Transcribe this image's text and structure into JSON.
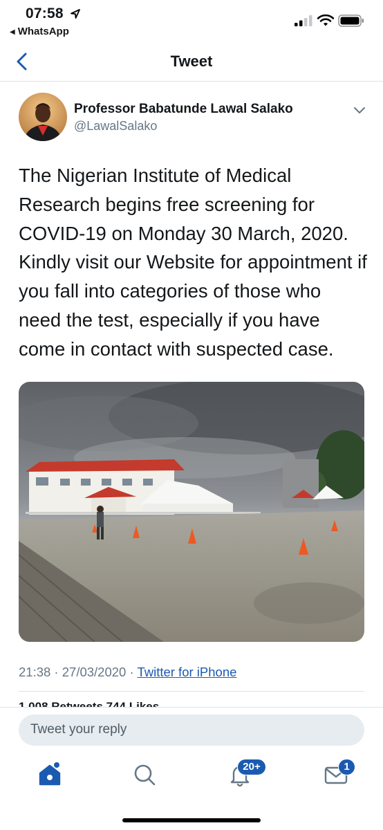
{
  "status_bar": {
    "time": "07:58",
    "back_app": "WhatsApp",
    "icons": [
      "location-arrow-icon",
      "signal-icon",
      "wifi-icon",
      "battery-icon"
    ]
  },
  "nav": {
    "title": "Tweet",
    "back_icon": "chevron-left-icon"
  },
  "tweet": {
    "author_name": "Professor Babatunde Lawal Salako",
    "author_handle": "@LawalSalako",
    "text": "The Nigerian Institute of Medical Research begins free screening for COVID-19 on Monday 30 March, 2020. Kindly visit our Website for appointment if you fall into categories of those who need the test, especially if you have come in contact with suspected case.",
    "timestamp": "21:38 · 27/03/2020 · ",
    "source": "Twitter for iPhone",
    "stats_peek": "1,008 Retweets  744 Likes"
  },
  "reply": {
    "placeholder": "Tweet your reply"
  },
  "tabbar": {
    "tabs": [
      "home-icon",
      "search-icon",
      "notifications-icon",
      "messages-icon"
    ],
    "notifications_badge": "20+",
    "messages_badge": "1"
  },
  "colors": {
    "accent": "#1b5ab1",
    "secondary_text": "#657786",
    "reply_bg": "#e6ecf0"
  }
}
